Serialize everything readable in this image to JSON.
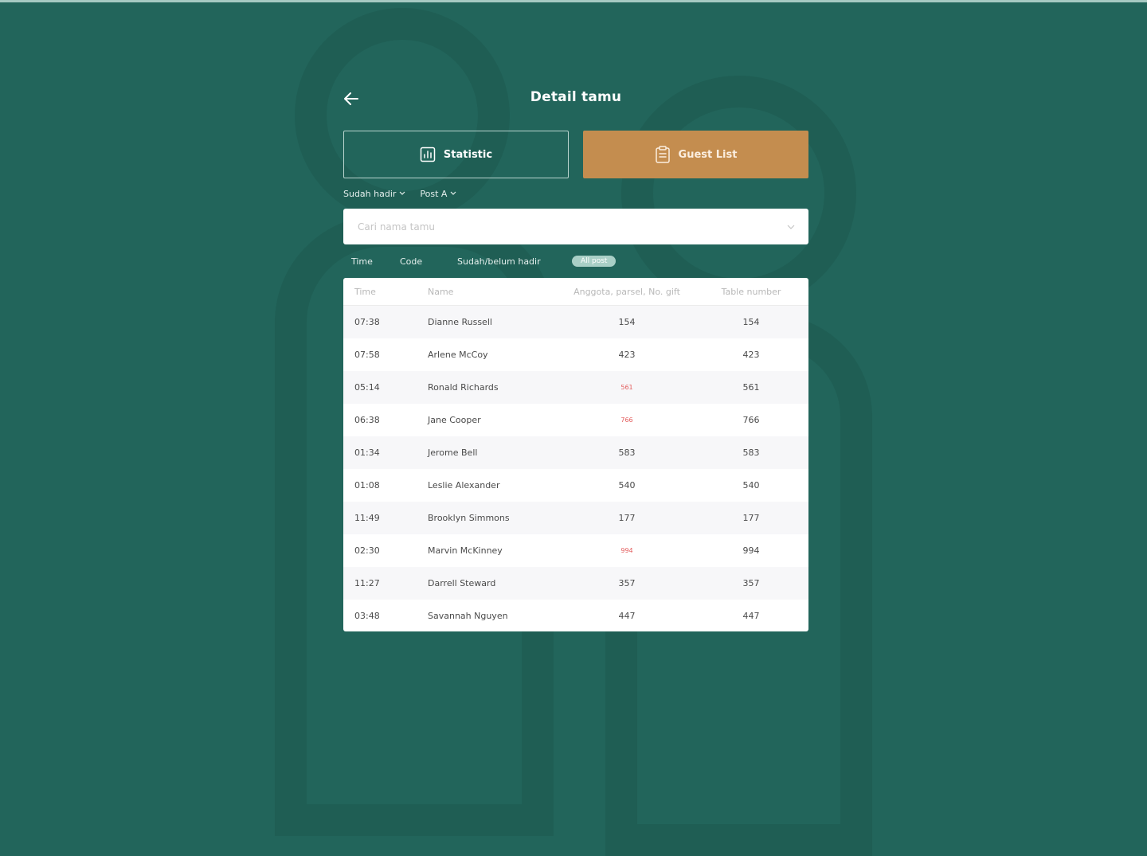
{
  "header": {
    "title": "Detail tamu",
    "back_icon": "arrow-left-icon"
  },
  "tabs": [
    {
      "label": "Statistic",
      "icon": "chart-icon",
      "active": false
    },
    {
      "label": "Guest List",
      "icon": "clipboard-icon",
      "active": true
    }
  ],
  "filters": {
    "status": "Sudah hadir",
    "post": "Post A"
  },
  "search": {
    "placeholder": "Cari nama tamu"
  },
  "sort": {
    "time": "Time",
    "code": "Code",
    "status": "Sudah/belum hadir",
    "post": "All post"
  },
  "table": {
    "headers": {
      "time": "Time",
      "name": "Name",
      "count": "Anggota, parsel, No. gift",
      "table_number": "Table number"
    },
    "rows": [
      {
        "time": "07:38",
        "name": "Dianne Russell",
        "count": "154",
        "table": "154",
        "alert": false
      },
      {
        "time": "07:58",
        "name": "Arlene McCoy",
        "count": "423",
        "table": "423",
        "alert": false
      },
      {
        "time": "05:14",
        "name": "Ronald Richards",
        "count": "561",
        "table": "561",
        "alert": true
      },
      {
        "time": "06:38",
        "name": "Jane Cooper",
        "count": "766",
        "table": "766",
        "alert": true
      },
      {
        "time": "01:34",
        "name": "Jerome Bell",
        "count": "583",
        "table": "583",
        "alert": false
      },
      {
        "time": "01:08",
        "name": "Leslie Alexander",
        "count": "540",
        "table": "540",
        "alert": false
      },
      {
        "time": "11:49",
        "name": "Brooklyn Simmons",
        "count": "177",
        "table": "177",
        "alert": false
      },
      {
        "time": "02:30",
        "name": "Marvin McKinney",
        "count": "994",
        "table": "994",
        "alert": true
      },
      {
        "time": "11:27",
        "name": "Darrell Steward",
        "count": "357",
        "table": "357",
        "alert": false
      },
      {
        "time": "03:48",
        "name": "Savannah Nguyen",
        "count": "447",
        "table": "447",
        "alert": false
      }
    ]
  },
  "colors": {
    "background": "#22655b",
    "accent": "#c48d4f",
    "alert": "#e35d5d",
    "pill": "#a9cfc6"
  }
}
